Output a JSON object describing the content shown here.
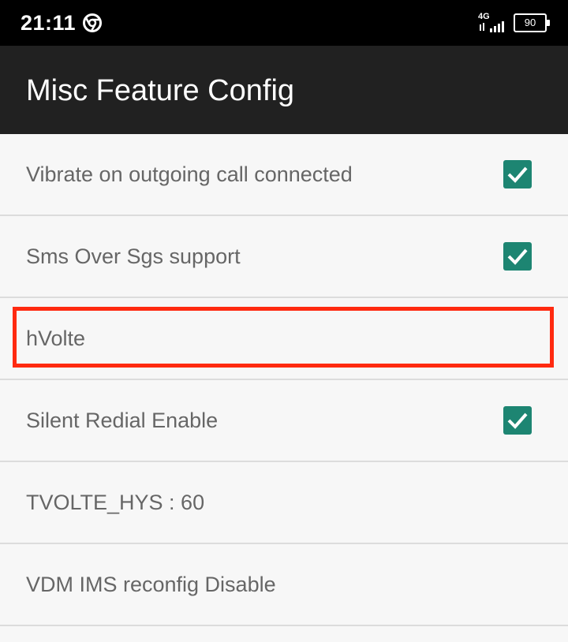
{
  "status_bar": {
    "time": "21:11",
    "network": "4G",
    "battery": "90",
    "icons": [
      "chrome-icon",
      "signal-icon",
      "battery-icon"
    ]
  },
  "app_bar": {
    "title": "Misc Feature Config"
  },
  "items": [
    {
      "label": "Vibrate on outgoing call connected",
      "checked": true
    },
    {
      "label": "Sms Over Sgs support",
      "checked": true
    },
    {
      "label": "hVolte",
      "checked": false
    },
    {
      "label": "Silent Redial Enable",
      "checked": true
    },
    {
      "label": "TVOLTE_HYS : 60",
      "checked": false
    },
    {
      "label": "VDM IMS reconfig Disable",
      "checked": false
    }
  ],
  "colors": {
    "checkbox": "#1d8572",
    "highlight": "#ff2a10",
    "app_bar": "#212121"
  }
}
